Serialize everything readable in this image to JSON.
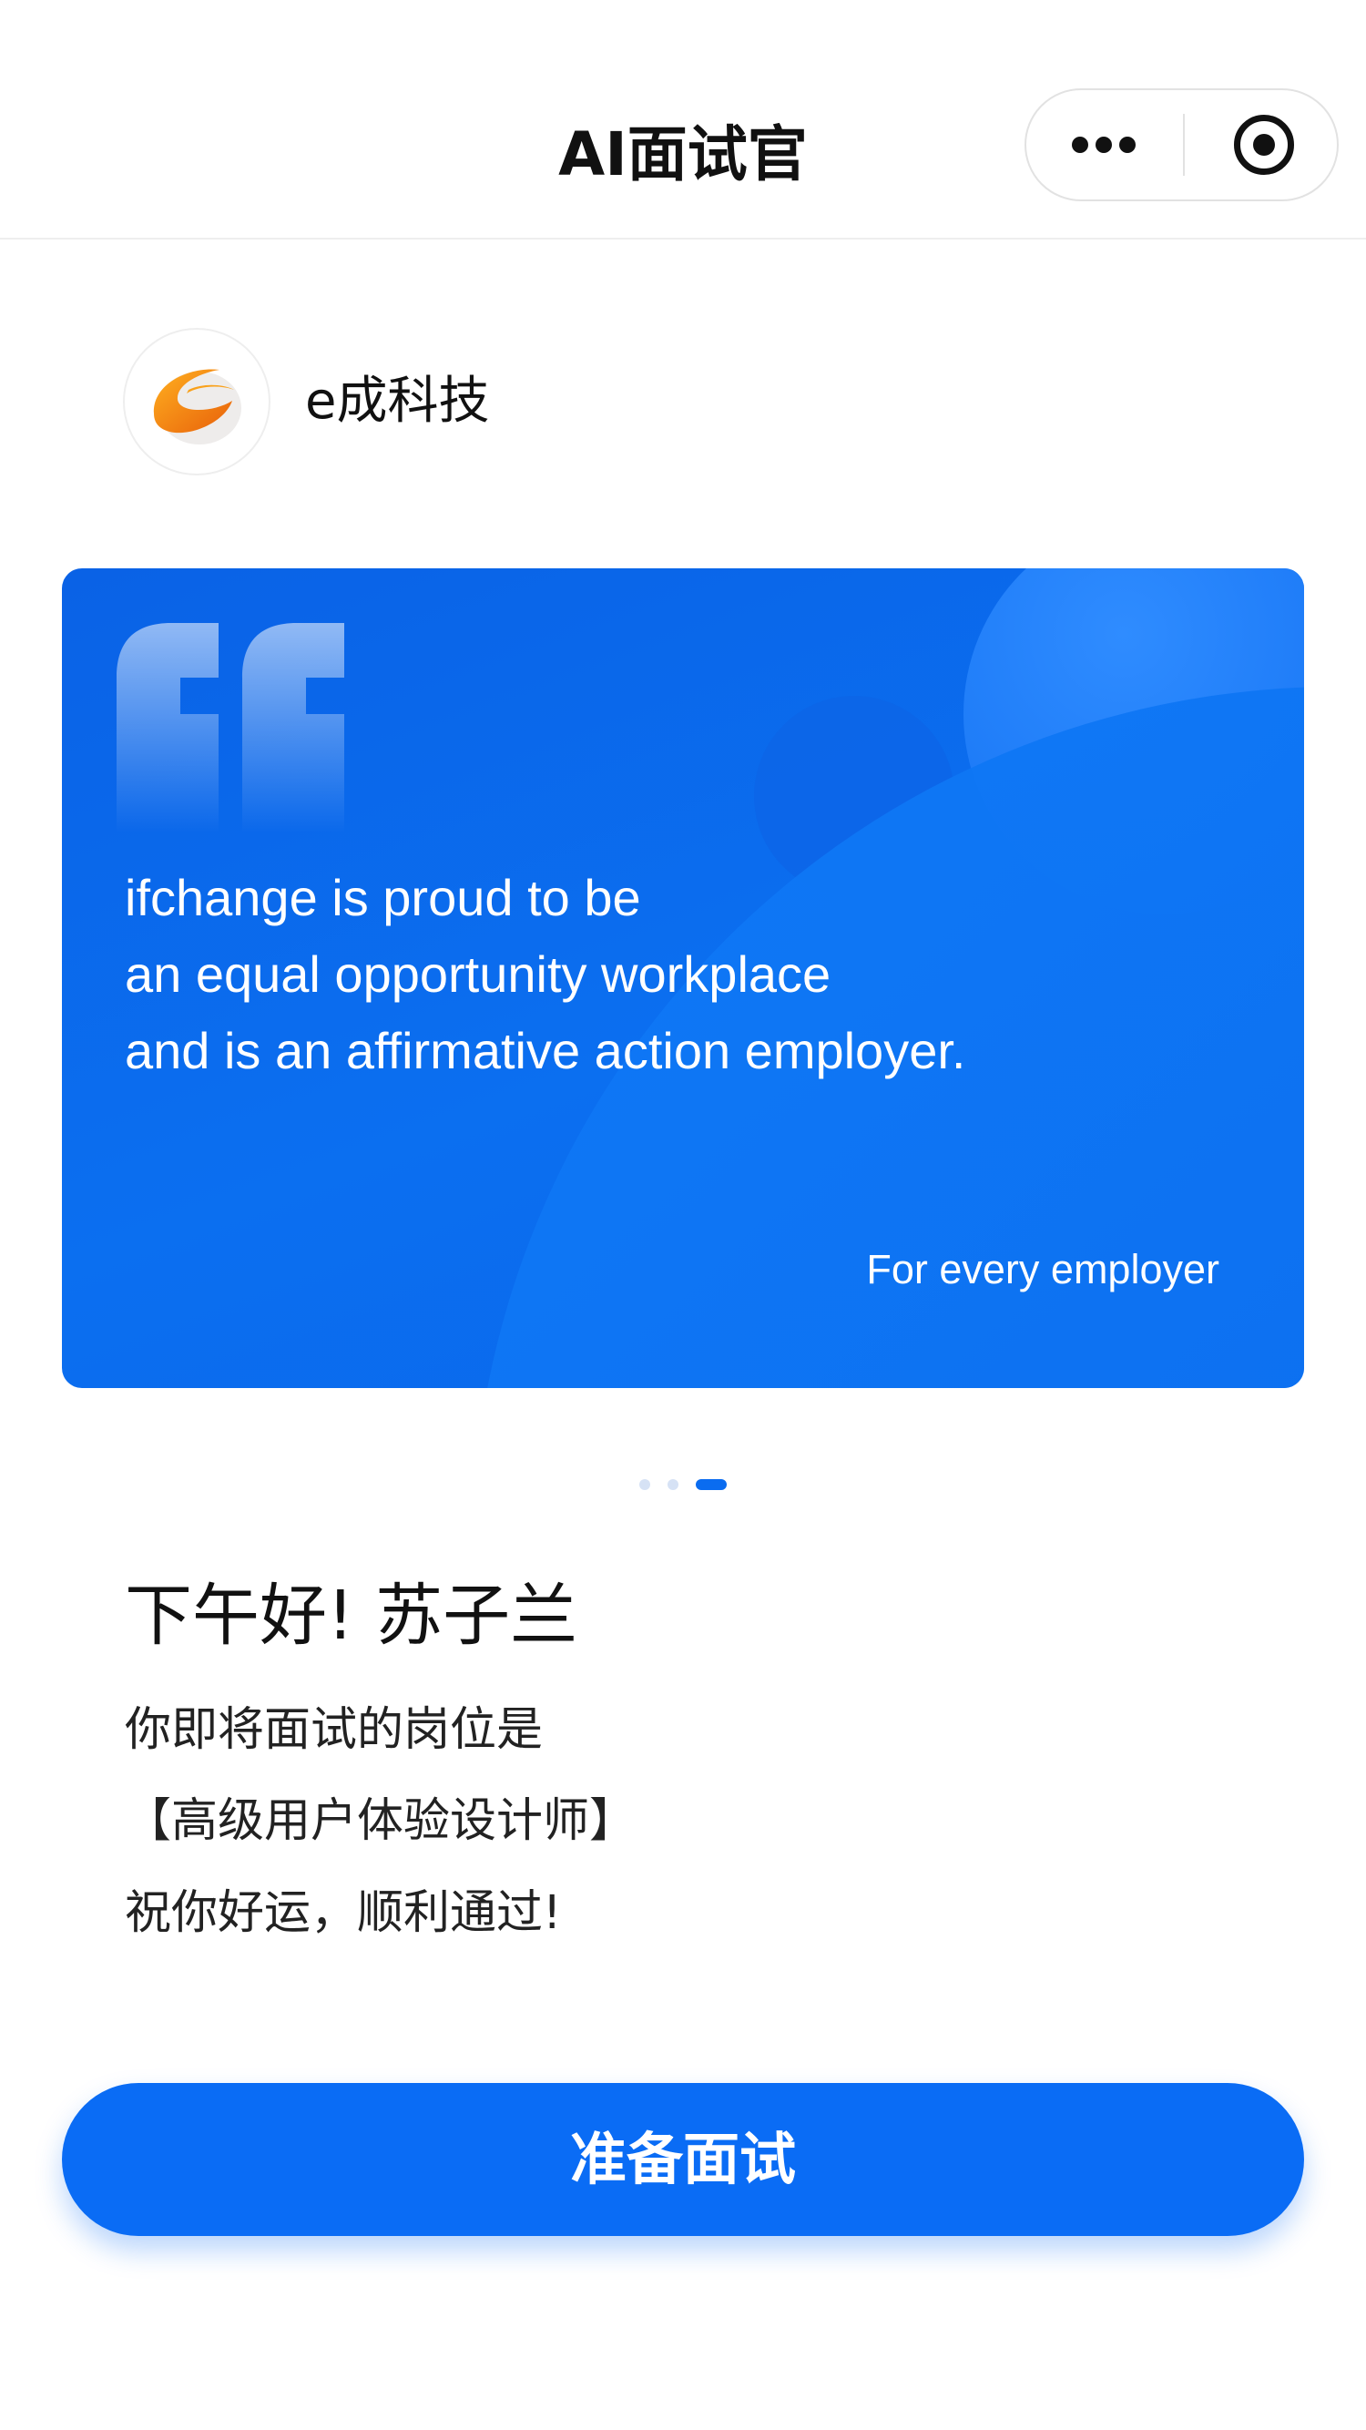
{
  "nav": {
    "title": "AI面试官"
  },
  "company": {
    "name": "e成科技"
  },
  "banner": {
    "quote_lines": [
      "ifchange is proud to be",
      "an equal opportunity workplace",
      "and is an affirmative action employer."
    ],
    "tagline": "For every employer",
    "slide_count": 3,
    "active_slide": 3,
    "colors": {
      "card": "#0a66ea",
      "indicator_active": "#0a6cf0",
      "indicator_inactive": "#d6e2f5"
    }
  },
  "greeting": {
    "title": "下午好! 苏子兰",
    "lines": [
      "你即将面试的岗位是",
      "【高级用户体验设计师】",
      "祝你好运，顺利通过!"
    ]
  },
  "actions": {
    "primary_label": "准备面试",
    "primary_color": "#0a6cf5"
  },
  "icons": {
    "more": "more-dots-icon",
    "close": "close-target-icon",
    "logo": "echeng-logo-icon",
    "quote": "quote-mark-icon"
  }
}
